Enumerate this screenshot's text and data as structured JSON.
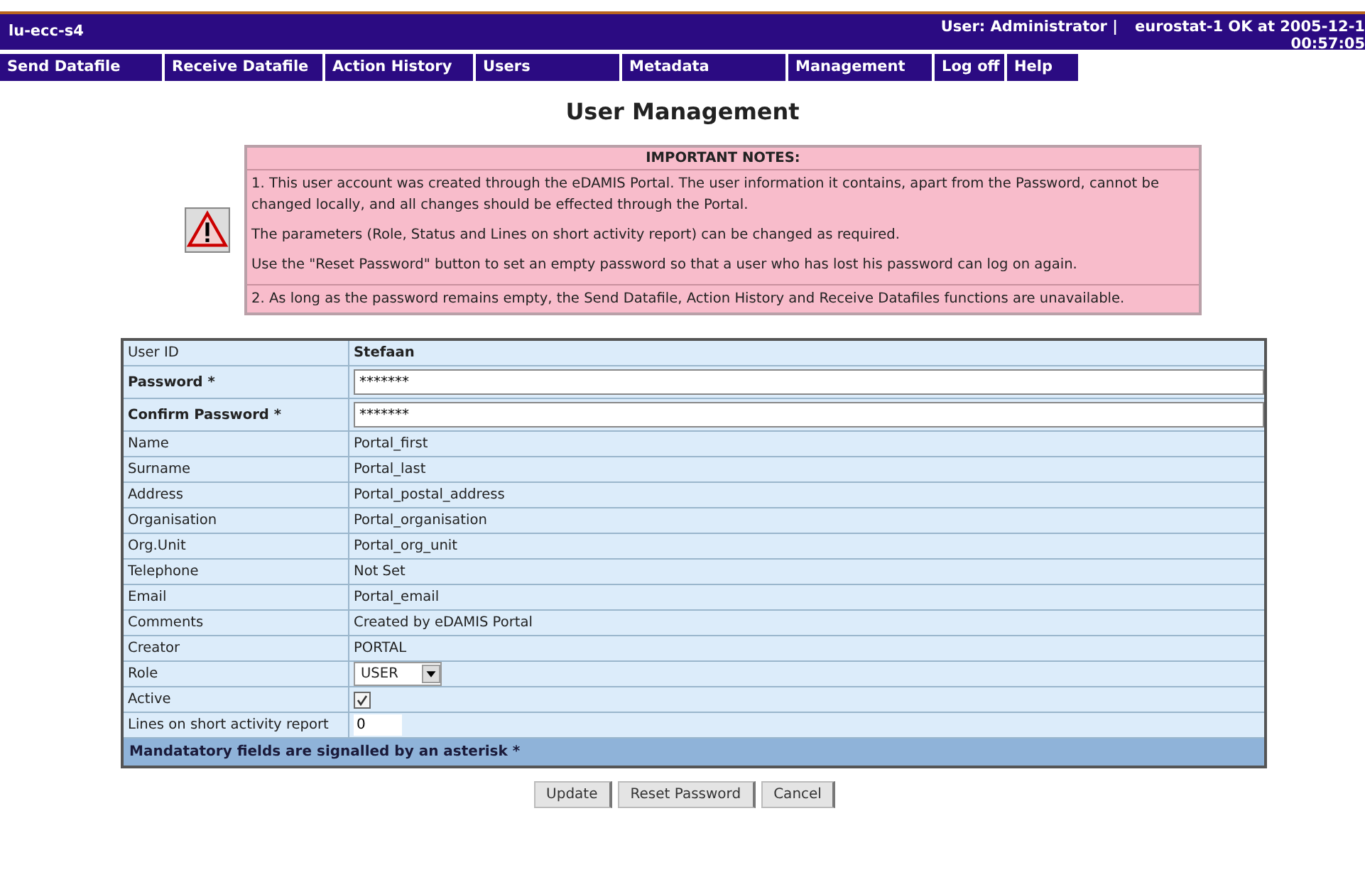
{
  "header": {
    "host": "lu-ecc-s4",
    "user": "User: Administrator |",
    "status_line_1": "eurostat-1 OK at 2005-12-1",
    "status_line_2": "00:57:05"
  },
  "nav": [
    {
      "label": "Send Datafile"
    },
    {
      "label": "Receive Datafile"
    },
    {
      "label": "Action History"
    },
    {
      "label": "Users"
    },
    {
      "label": "Metadata"
    },
    {
      "label": "Management"
    },
    {
      "label": "Log off"
    },
    {
      "label": "Help"
    }
  ],
  "page_title": "User Management",
  "notes": {
    "title": "IMPORTANT NOTES:",
    "sections": [
      [
        "1. This user account was created through the eDAMIS Portal. The user information it contains, apart from the Password, cannot be changed locally, and all changes should be effected through the Portal.",
        "The parameters (Role, Status and Lines on short activity report) can be changed as required.",
        "Use the \"Reset Password\" button to set an empty password so that a user who has lost his password can log on again."
      ],
      [
        "2. As long as the password remains empty, the Send Datafile, Action History and Receive Datafiles functions are unavailable."
      ]
    ]
  },
  "form": {
    "rows": [
      {
        "label": "User ID",
        "kind": "bold",
        "value": "Stefaan"
      },
      {
        "label": "Password *",
        "kind": "password",
        "value": "*******"
      },
      {
        "label": "Confirm Password *",
        "kind": "password",
        "value": "*******"
      },
      {
        "label": "Name",
        "kind": "text",
        "value": "Portal_first"
      },
      {
        "label": "Surname",
        "kind": "text",
        "value": "Portal_last"
      },
      {
        "label": "Address",
        "kind": "text",
        "value": "Portal_postal_address"
      },
      {
        "label": "Organisation",
        "kind": "text",
        "value": "Portal_organisation"
      },
      {
        "label": "Org.Unit",
        "kind": "text",
        "value": "Portal_org_unit"
      },
      {
        "label": "Telephone",
        "kind": "text",
        "value": "Not Set"
      },
      {
        "label": "Email",
        "kind": "text",
        "value": "Portal_email"
      },
      {
        "label": "Comments",
        "kind": "text",
        "value": "Created by eDAMIS Portal"
      },
      {
        "label": "Creator",
        "kind": "text",
        "value": "PORTAL"
      },
      {
        "label": "Role",
        "kind": "select",
        "value": "USER"
      },
      {
        "label": "Active",
        "kind": "checkbox",
        "checked": true
      },
      {
        "label": "Lines on short activity report",
        "kind": "number",
        "value": "0"
      }
    ],
    "footer": "Mandatatory fields are signalled by an asterisk *"
  },
  "buttons": [
    "Update",
    "Reset Password",
    "Cancel"
  ]
}
